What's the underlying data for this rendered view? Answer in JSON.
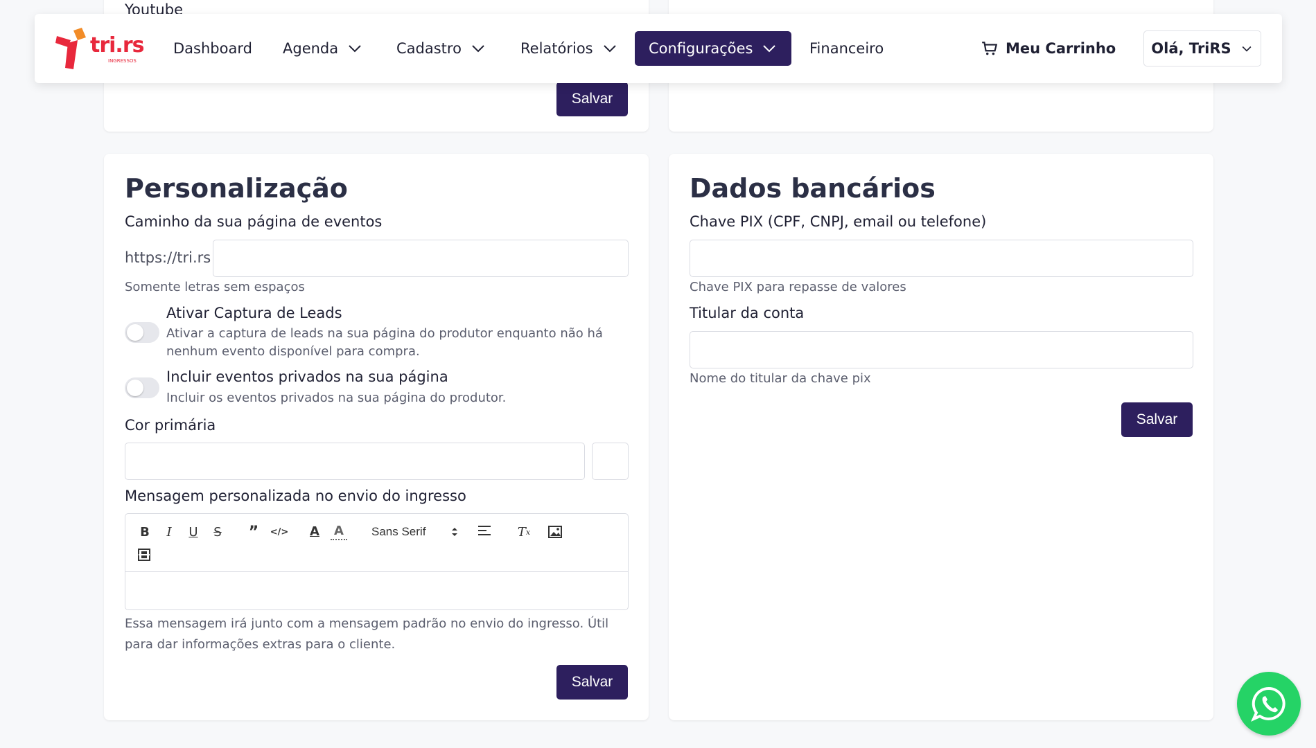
{
  "top_partial": {
    "label": "Youtube",
    "save_label": "Salvar"
  },
  "nav": {
    "brand": "tri.rs",
    "brand_sub": "INGRESSOS",
    "items": [
      {
        "label": "Dashboard"
      },
      {
        "label": "Agenda"
      },
      {
        "label": "Cadastro"
      },
      {
        "label": "Relatórios"
      },
      {
        "label": "Configurações"
      },
      {
        "label": "Financeiro"
      }
    ],
    "cart_label": "Meu Carrinho",
    "user_label": "Olá, TriRS"
  },
  "personalizacao": {
    "title": "Personalização",
    "path_label": "Caminho da sua página de eventos",
    "path_prefix": "https://tri.rs",
    "path_value": "",
    "path_help": "Somente letras sem espaços",
    "leads_title": "Ativar Captura de Leads",
    "leads_desc_line1": "Ativar a captura de leads na sua página do produtor enquanto não há",
    "leads_desc_line2": "nenhum evento disponível para compra.",
    "leads_enabled": false,
    "private_title": "Incluir eventos privados na sua página",
    "private_desc": "Incluir os eventos privados na sua página do produtor.",
    "private_enabled": false,
    "color_label": "Cor primária",
    "color_value": "",
    "message_label": "Mensagem personalizada no envio do ingresso",
    "font_select": "Sans Serif",
    "message_help_line1": "Essa mensagem irá junto com a mensagem padrão no envio do ingresso. Útil",
    "message_help_line2": "para dar informações extras para o cliente.",
    "save_label": "Salvar"
  },
  "bancarios": {
    "title": "Dados bancários",
    "pix_label": "Chave PIX (CPF, CNPJ, email ou telefone)",
    "pix_value": "",
    "pix_help": "Chave PIX para repasse de valores",
    "holder_label": "Titular da conta",
    "holder_value": "",
    "holder_help": "Nome do titular da chave pix",
    "save_label": "Salvar"
  },
  "colors": {
    "primary": "#2d1f5e",
    "brand_red": "#e8283c",
    "brand_orange": "#f28c28",
    "whatsapp": "#25d366"
  }
}
